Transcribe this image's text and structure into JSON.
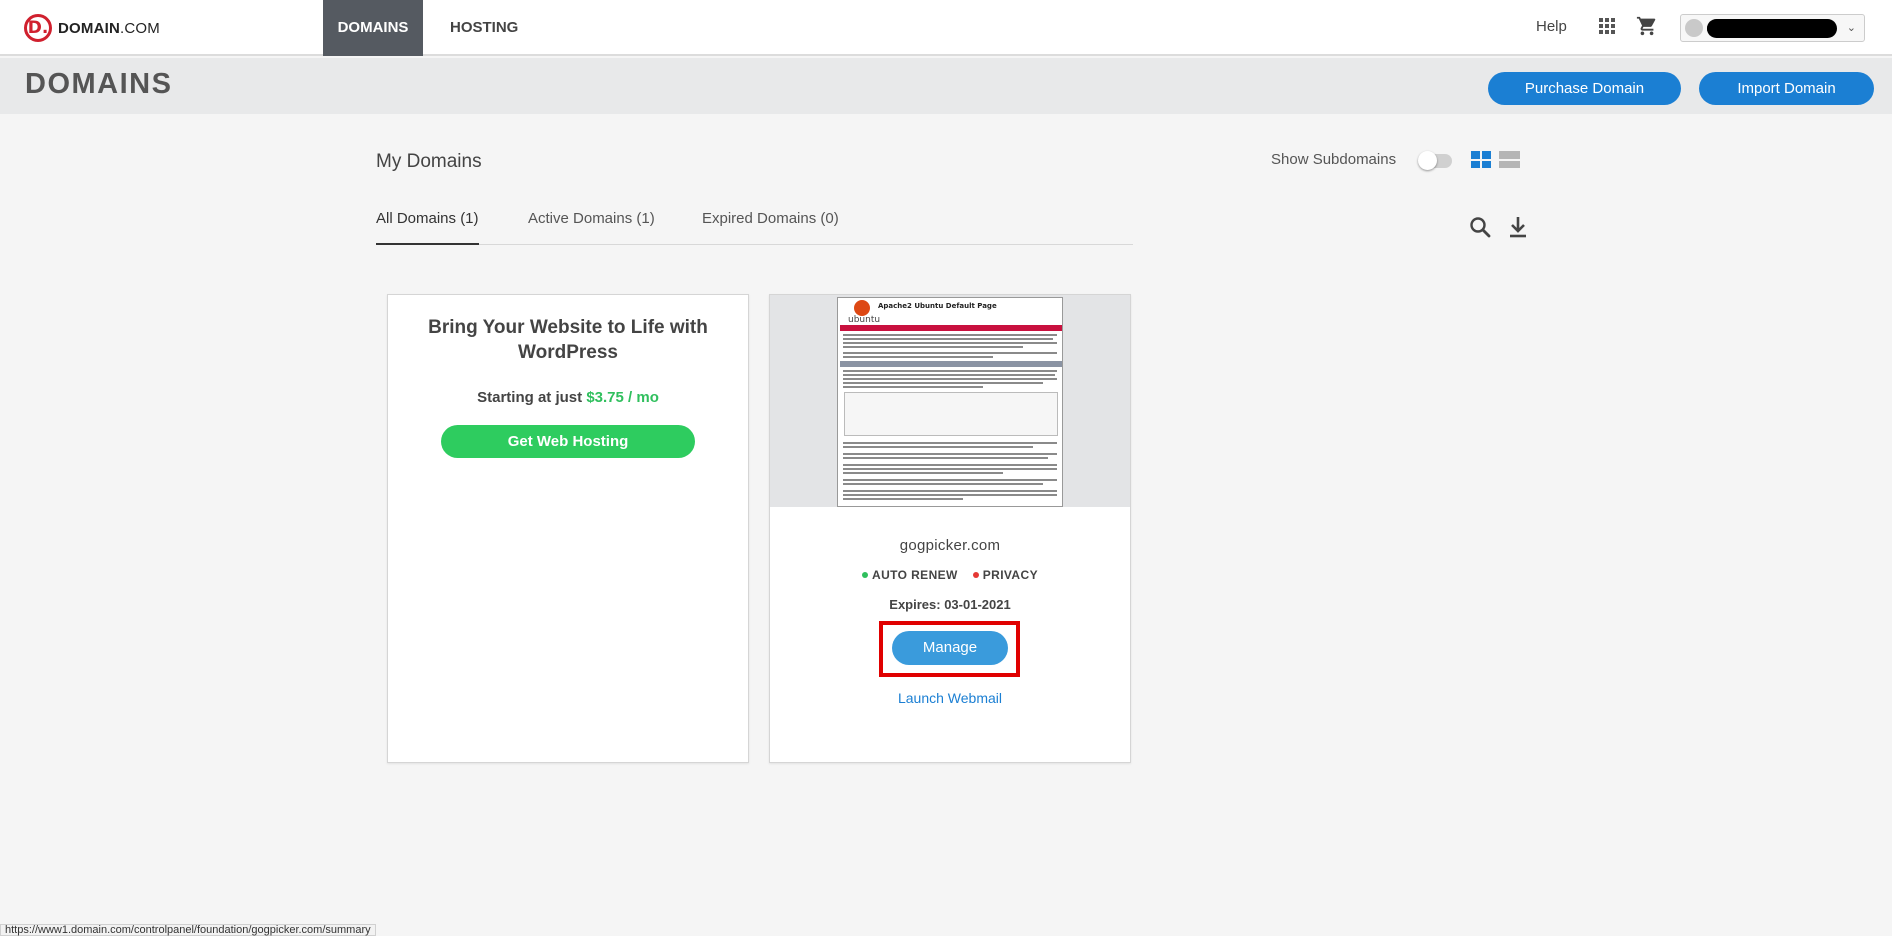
{
  "brand": {
    "logo_glyph": "D.",
    "name_bold": "DOMAIN",
    "name_light": ".COM",
    "color": "#d0202e"
  },
  "nav": {
    "tabs": [
      {
        "label": "DOMAINS",
        "active": true
      },
      {
        "label": "HOSTING",
        "active": false
      }
    ],
    "help": "Help",
    "apps_icon": "grid-icon",
    "cart_icon": "cart-icon",
    "account_name": "██████████"
  },
  "header": {
    "title": "DOMAINS",
    "purchase_button": "Purchase Domain",
    "import_button": "Import Domain"
  },
  "main": {
    "section_title": "My Domains",
    "show_subdomains_label": "Show Subdomains",
    "show_subdomains_on": false,
    "tabs": [
      {
        "label": "All Domains (1)",
        "active": true
      },
      {
        "label": "Active Domains (1)",
        "active": false
      },
      {
        "label": "Expired Domains (0)",
        "active": false
      }
    ]
  },
  "promo": {
    "title": "Bring Your Website to Life with WordPress",
    "price_prefix": "Starting at just",
    "price": "$3.75 / mo",
    "button": "Get Web Hosting"
  },
  "domain_card": {
    "thumb_title": "Apache2 Ubuntu Default Page",
    "thumb_logo_text": "ubuntu",
    "domain": "gogpicker.com",
    "auto_renew": "AUTO RENEW",
    "auto_renew_color": "#2fbf5d",
    "privacy": "PRIVACY",
    "privacy_color": "#e53935",
    "expires": "Expires: 03-01-2021",
    "manage_button": "Manage",
    "webmail_link": "Launch Webmail"
  },
  "status_url": "https://www1.domain.com/controlpanel/foundation/gogpicker.com/summary"
}
